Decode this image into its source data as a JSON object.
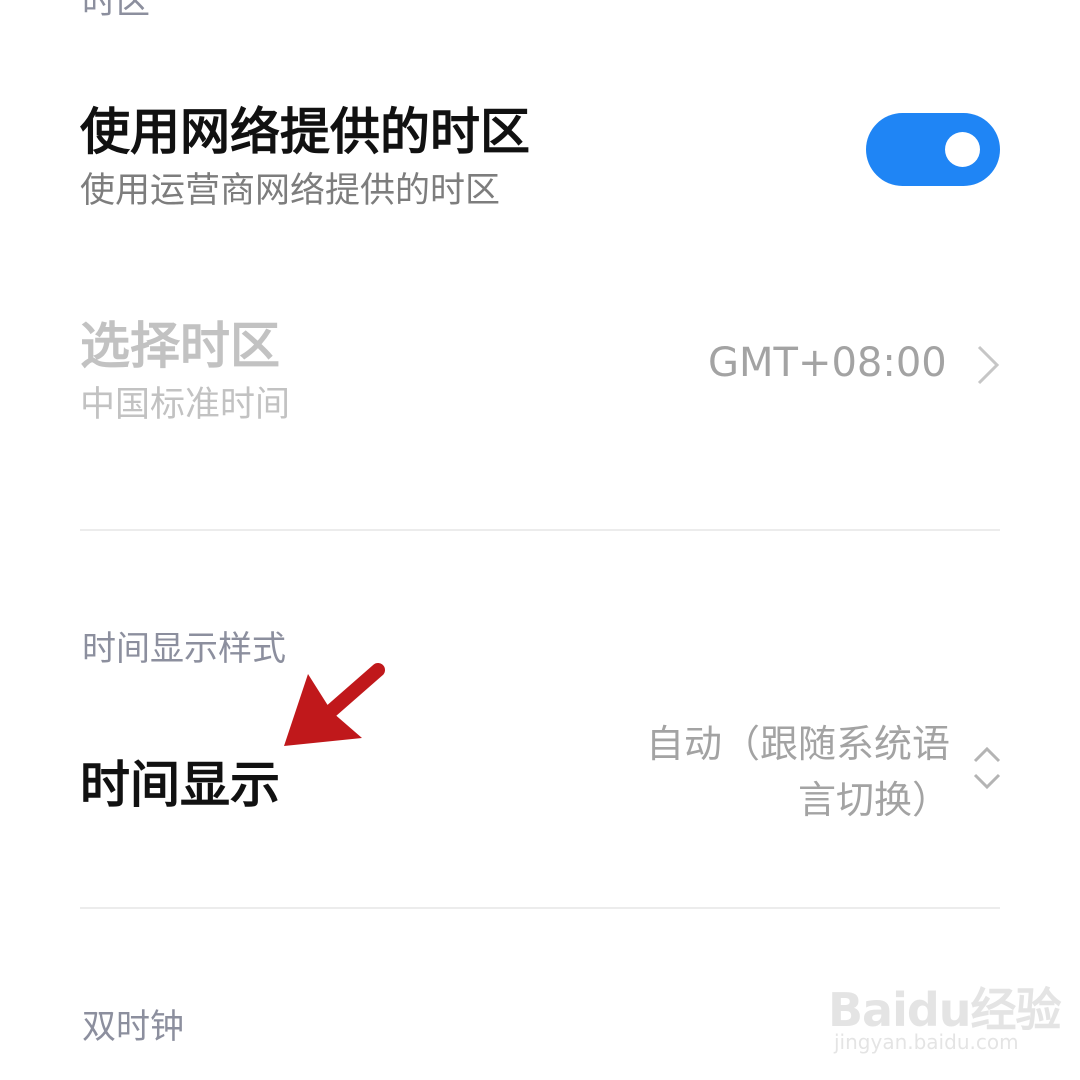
{
  "sections": {
    "timezone_header": "时区",
    "time_style_header": "时间显示样式",
    "dual_clock_header": "双时钟"
  },
  "rows": {
    "network_timezone": {
      "title": "使用网络提供的时区",
      "subtitle": "使用运营商网络提供的时区",
      "toggle_on": true
    },
    "select_timezone": {
      "title": "选择时区",
      "subtitle": "中国标准时间",
      "value": "GMT+08:00"
    },
    "time_display": {
      "title": "时间显示",
      "value_line1": "自动（跟随系统语",
      "value_line2": "言切换）"
    }
  },
  "icons": {
    "chevron_right": "chevron-right-icon",
    "updown": "chevron-updown-icon",
    "annotation": "red-arrow-icon"
  },
  "colors": {
    "accent": "#1f85f5",
    "annotation_red": "#c0181b"
  },
  "watermark": {
    "brand": "Baidu经验",
    "url": "jingyan.baidu.com"
  }
}
